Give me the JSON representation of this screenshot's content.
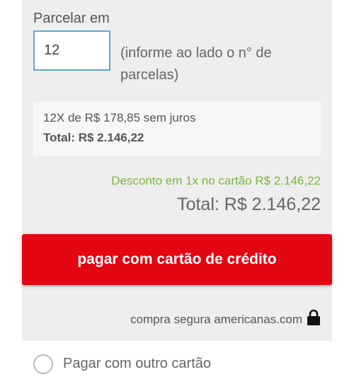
{
  "installments": {
    "label": "Parcelar em",
    "value": "12",
    "hint": "(informe ao lado o n° de parcelas)"
  },
  "summary": {
    "line": "12X de R$ 178,85 sem juros",
    "total": "Total: R$ 2.146,22"
  },
  "discount": "Desconto em 1x no cartão R$ 2.146,22",
  "grand_total": "Total: R$ 2.146,22",
  "pay_button": {
    "label": "pagar com cartão de crédito"
  },
  "secure": {
    "text": "compra segura americanas.com",
    "icon": "lock-icon"
  },
  "other_card": {
    "label": "Pagar com outro cartão",
    "selected": false
  },
  "colors": {
    "button": "#e30613",
    "discount": "#7ab83b",
    "input_border": "#5aa9c9",
    "panel": "#eeeeee"
  }
}
